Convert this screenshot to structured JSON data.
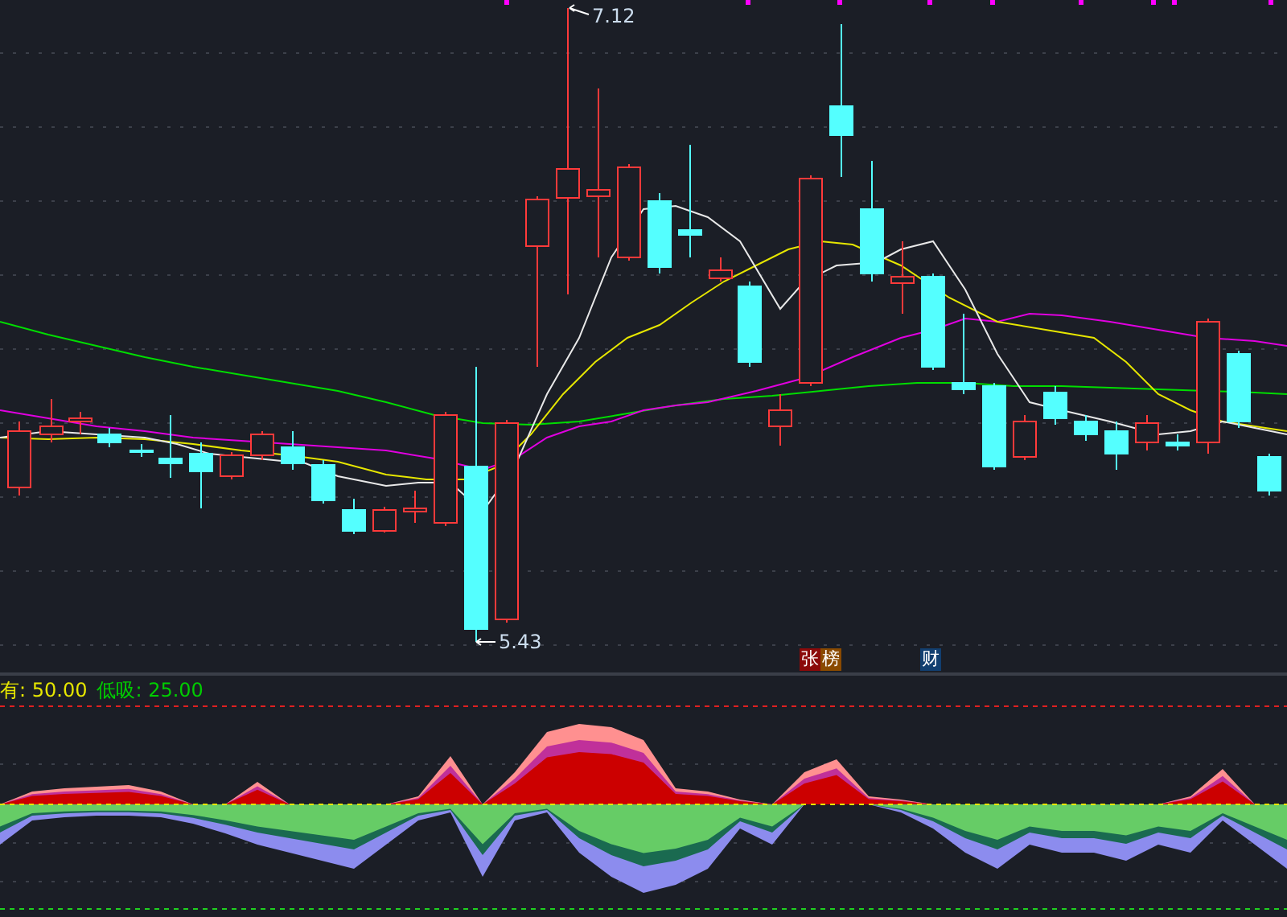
{
  "price_labels": [
    {
      "text": "7.12"
    },
    {
      "text": "5.43"
    }
  ],
  "markers": [
    {
      "text": "张",
      "color": "#8b0a0a"
    },
    {
      "text": "榜",
      "color": "#8a4a00"
    },
    {
      "text": "财",
      "color": "#123f70"
    }
  ],
  "indicator_legend": [
    {
      "label": "有: 50.00",
      "color": "#e6e600"
    },
    {
      "label": "低吸: 25.00",
      "color": "#00cc00"
    }
  ]
}
